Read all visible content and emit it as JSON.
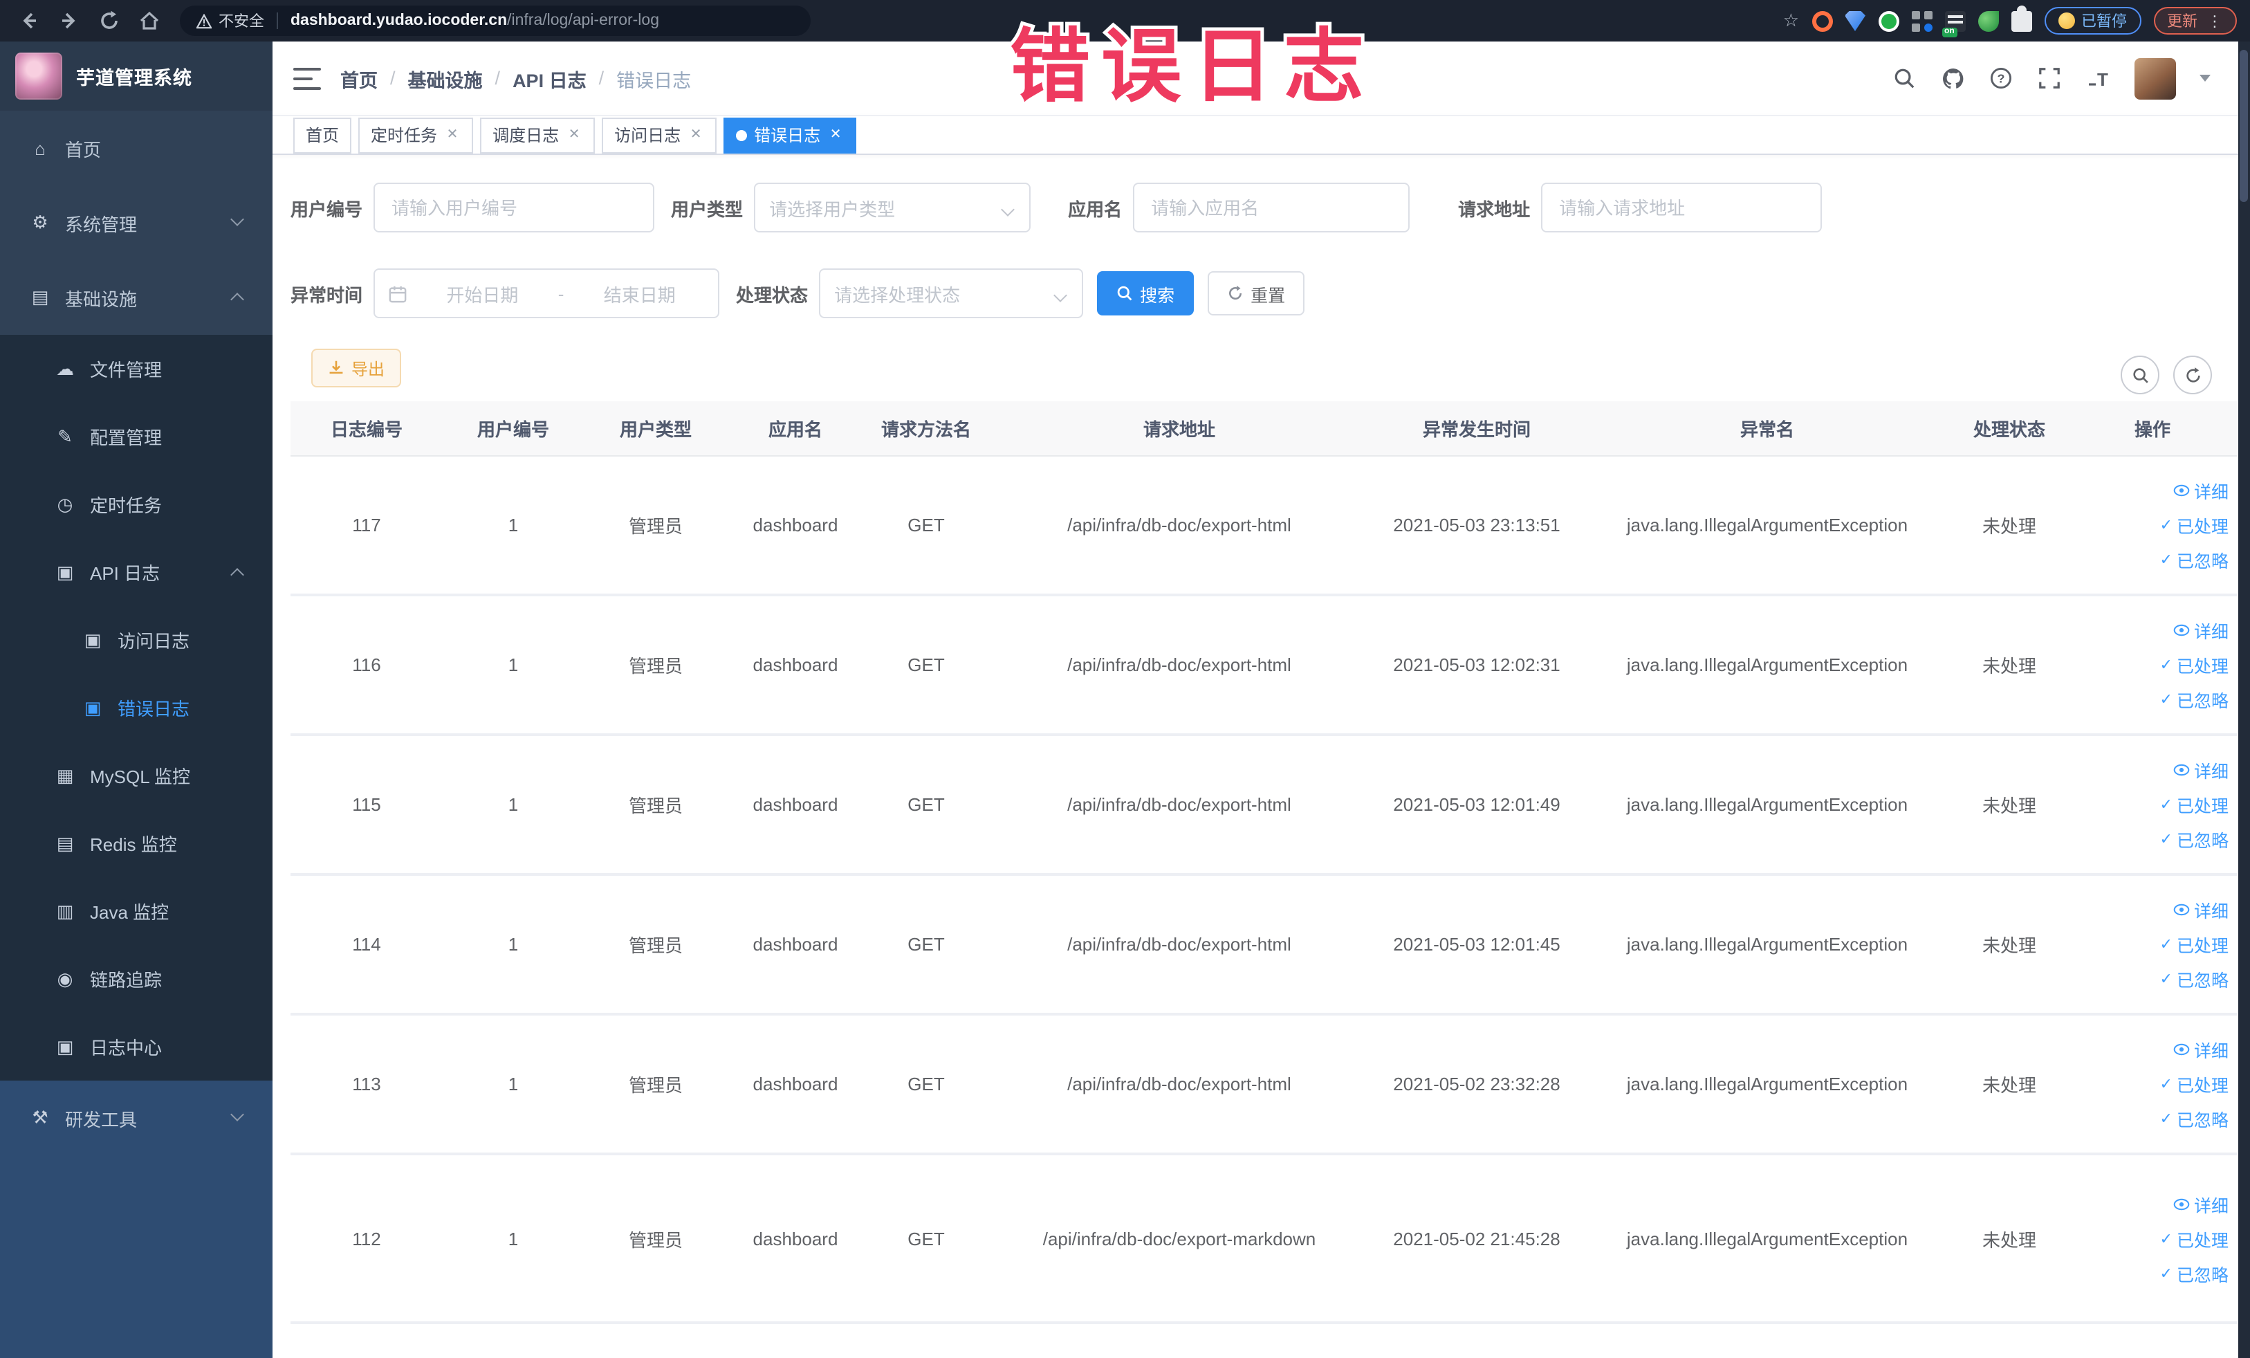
{
  "browser": {
    "security_label": "不安全",
    "url_host": "dashboard.yudao.iocoder.cn",
    "url_path": "/infra/log/api-error-log",
    "paused_badge": "已暂停",
    "update_badge": "更新"
  },
  "annotation": {
    "text": "错误日志",
    "color": "#ee3a5f"
  },
  "sidebar": {
    "title": "芋道管理系统",
    "items": [
      {
        "label": "首页"
      },
      {
        "label": "系统管理"
      },
      {
        "label": "基础设施"
      },
      {
        "label": "文件管理"
      },
      {
        "label": "配置管理"
      },
      {
        "label": "定时任务"
      },
      {
        "label": "API 日志"
      },
      {
        "label": "访问日志"
      },
      {
        "label": "错误日志"
      },
      {
        "label": "MySQL 监控"
      },
      {
        "label": "Redis 监控"
      },
      {
        "label": "Java 监控"
      },
      {
        "label": "链路追踪"
      },
      {
        "label": "日志中心"
      },
      {
        "label": "研发工具"
      }
    ]
  },
  "breadcrumb": {
    "separator": "/",
    "items": [
      "首页",
      "基础设施",
      "API 日志",
      "错误日志"
    ]
  },
  "tabs": [
    {
      "label": "首页"
    },
    {
      "label": "定时任务"
    },
    {
      "label": "调度日志"
    },
    {
      "label": "访问日志"
    },
    {
      "label": "错误日志"
    }
  ],
  "filters": {
    "user_id_label": "用户编号",
    "user_id_placeholder": "请输入用户编号",
    "user_type_label": "用户类型",
    "user_type_placeholder": "请选择用户类型",
    "app_name_label": "应用名",
    "app_name_placeholder": "请输入应用名",
    "request_url_label": "请求地址",
    "request_url_placeholder": "请输入请求地址",
    "exception_time_label": "异常时间",
    "date_start_placeholder": "开始日期",
    "date_separator": "-",
    "date_end_placeholder": "结束日期",
    "process_status_label": "处理状态",
    "process_status_placeholder": "请选择处理状态",
    "search_label": "搜索",
    "reset_label": "重置"
  },
  "toolbar": {
    "export_label": "导出"
  },
  "table": {
    "columns": [
      "日志编号",
      "用户编号",
      "用户类型",
      "应用名",
      "请求方法名",
      "请求地址",
      "异常发生时间",
      "异常名",
      "处理状态",
      "操作"
    ],
    "action_labels": [
      "详细",
      "已处理",
      "已忽略"
    ],
    "rows": [
      {
        "id": "117",
        "user_id": "1",
        "user_type": "管理员",
        "app": "dashboard",
        "method": "GET",
        "url": "/api/infra/db-doc/export-html",
        "time": "2021-05-03 23:13:51",
        "exception": "java.lang.IllegalArgumentException",
        "status": "未处理"
      },
      {
        "id": "116",
        "user_id": "1",
        "user_type": "管理员",
        "app": "dashboard",
        "method": "GET",
        "url": "/api/infra/db-doc/export-html",
        "time": "2021-05-03 12:02:31",
        "exception": "java.lang.IllegalArgumentException",
        "status": "未处理"
      },
      {
        "id": "115",
        "user_id": "1",
        "user_type": "管理员",
        "app": "dashboard",
        "method": "GET",
        "url": "/api/infra/db-doc/export-html",
        "time": "2021-05-03 12:01:49",
        "exception": "java.lang.IllegalArgumentException",
        "status": "未处理"
      },
      {
        "id": "114",
        "user_id": "1",
        "user_type": "管理员",
        "app": "dashboard",
        "method": "GET",
        "url": "/api/infra/db-doc/export-html",
        "time": "2021-05-03 12:01:45",
        "exception": "java.lang.IllegalArgumentException",
        "status": "未处理"
      },
      {
        "id": "113",
        "user_id": "1",
        "user_type": "管理员",
        "app": "dashboard",
        "method": "GET",
        "url": "/api/infra/db-doc/export-html",
        "time": "2021-05-02 23:32:28",
        "exception": "java.lang.IllegalArgumentException",
        "status": "未处理"
      },
      {
        "id": "112",
        "user_id": "1",
        "user_type": "管理员",
        "app": "dashboard",
        "method": "GET",
        "url": "/api/infra/db-doc/export-markdown",
        "time": "2021-05-02 21:45:28",
        "exception": "java.lang.IllegalArgumentException",
        "status": "未处理"
      }
    ]
  },
  "colors": {
    "primary": "#409eff",
    "tab_active": "#2d8cf0",
    "warning": "#e6a23c",
    "sidebar_bg": "#304156",
    "submenu_bg": "#1f2d3d"
  }
}
